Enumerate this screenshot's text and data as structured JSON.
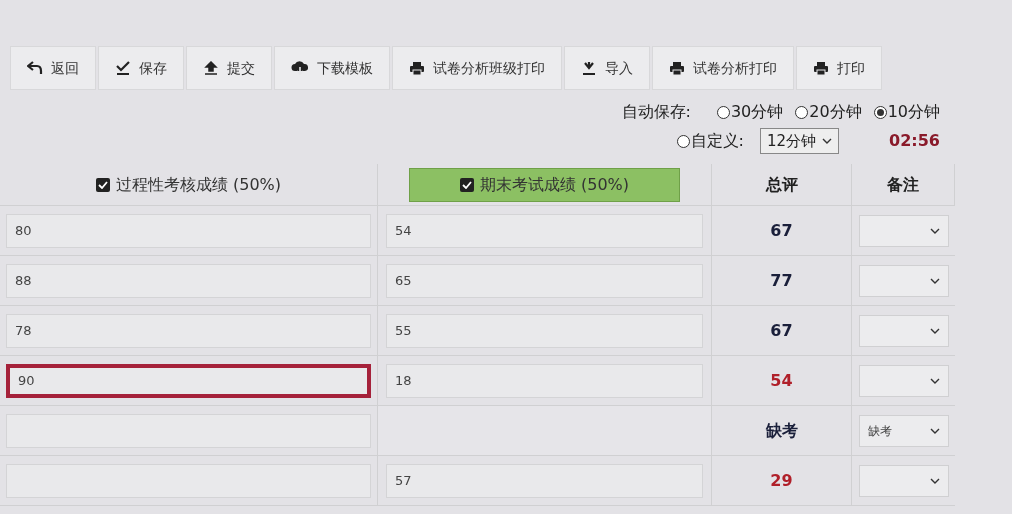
{
  "toolbar": [
    {
      "label": "返回",
      "kind": "back"
    },
    {
      "label": "保存",
      "kind": "save"
    },
    {
      "label": "提交",
      "kind": "submit"
    },
    {
      "label": "下载模板",
      "kind": "download"
    },
    {
      "label": "试卷分析班级打印",
      "kind": "print"
    },
    {
      "label": "导入",
      "kind": "import"
    },
    {
      "label": "试卷分析打印",
      "kind": "print"
    },
    {
      "label": "打印",
      "kind": "print"
    }
  ],
  "autosave": {
    "label": "自动保存:",
    "options": [
      {
        "label": "30分钟",
        "selected": false
      },
      {
        "label": "20分钟",
        "selected": false
      },
      {
        "label": "10分钟",
        "selected": true
      }
    ],
    "custom": {
      "label": "自定义:",
      "selected": false,
      "value": "12分钟"
    },
    "countdown": "02:56"
  },
  "table": {
    "columns": [
      {
        "label": "过程性考核成绩 (50%)",
        "checked": true,
        "highlight": false
      },
      {
        "label": "期末考试成绩 (50%)",
        "checked": true,
        "highlight": true
      },
      {
        "label": "总评"
      },
      {
        "label": "备注"
      }
    ],
    "rows": [
      {
        "process": "80",
        "final": "54",
        "total": "67",
        "failing": false,
        "focused": false
      },
      {
        "process": "88",
        "final": "65",
        "total": "77",
        "failing": false,
        "focused": false
      },
      {
        "process": "78",
        "final": "55",
        "total": "67",
        "failing": false,
        "focused": false
      },
      {
        "process": "90",
        "final": "18",
        "total": "54",
        "failing": true,
        "focused": true
      },
      {
        "final_input": false,
        "total": "缺考",
        "failing": false,
        "focused": false,
        "remark": "缺考"
      },
      {
        "final": "57",
        "total": "29",
        "failing": true,
        "focused": false
      }
    ]
  }
}
